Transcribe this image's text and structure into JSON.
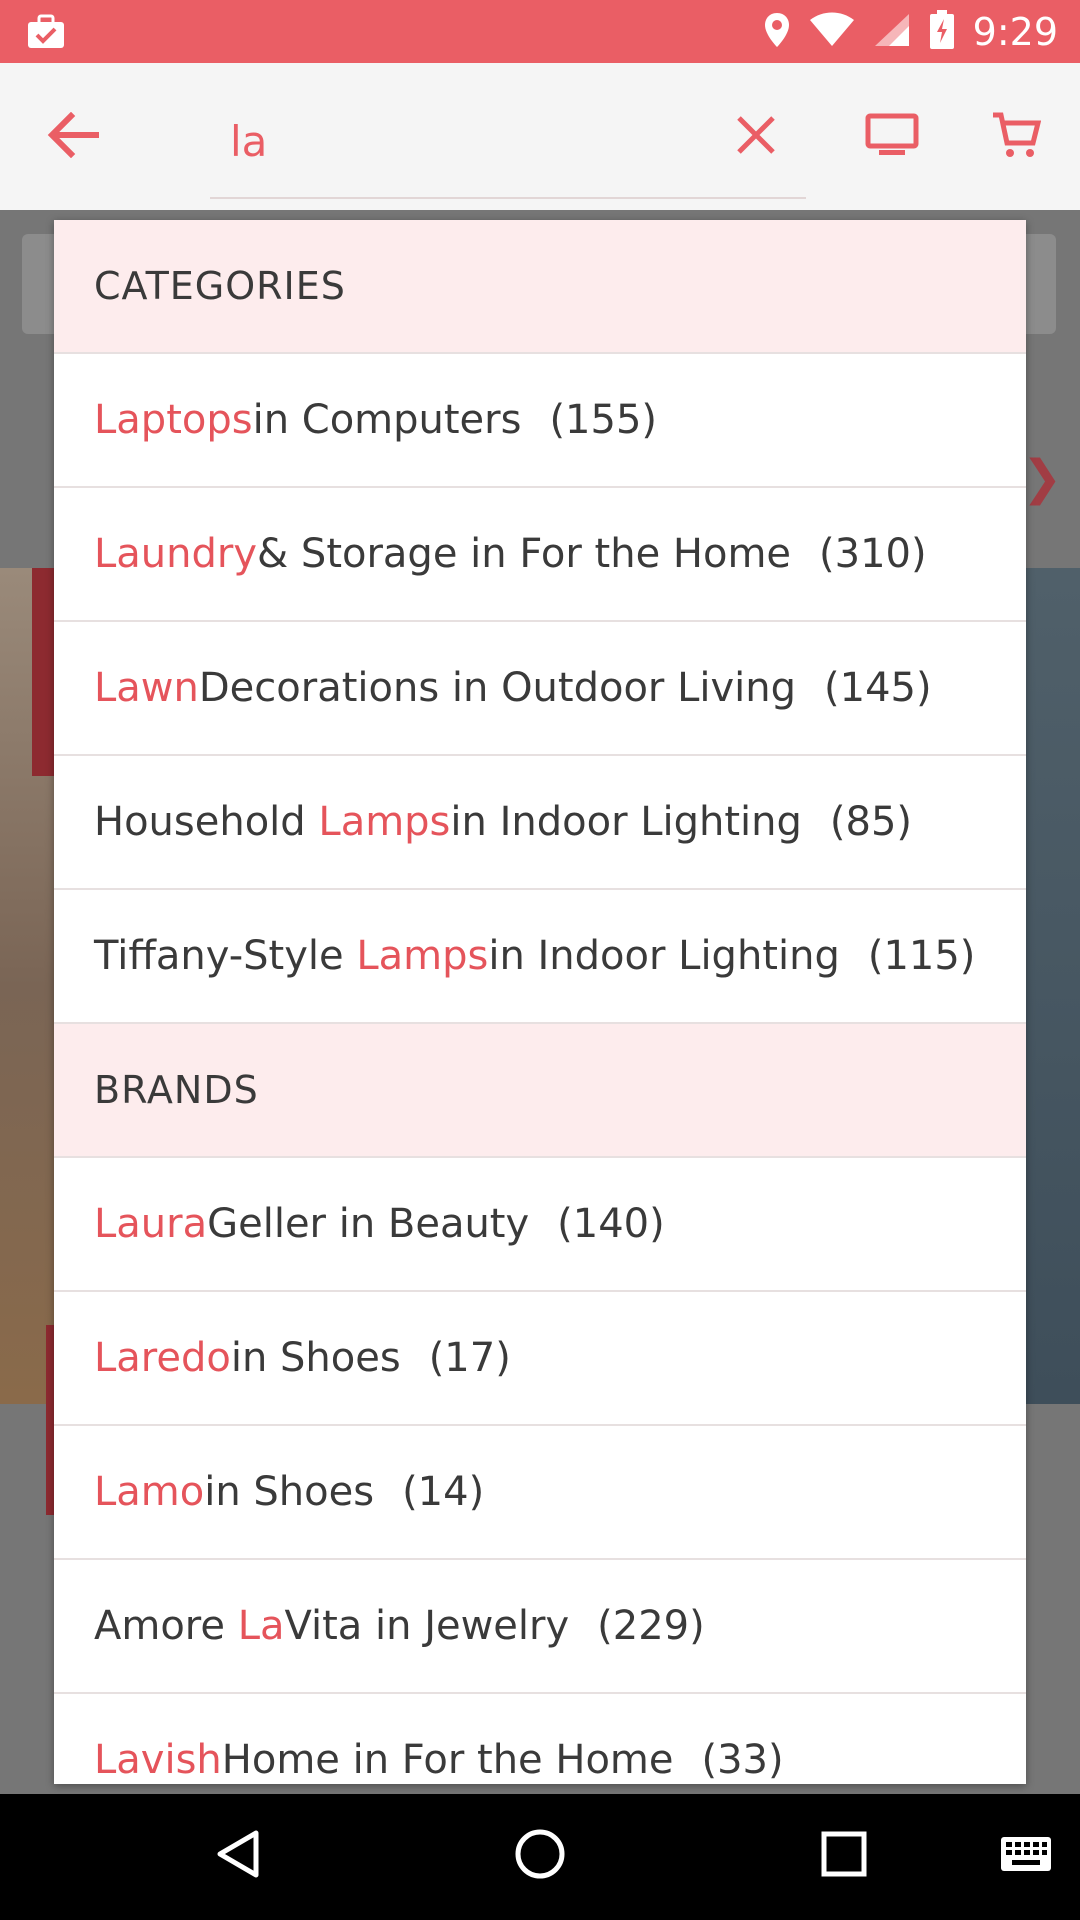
{
  "status_bar": {
    "time": "9:29"
  },
  "search": {
    "value": "la"
  },
  "colors": {
    "accent": "#ea5e65",
    "highlight": "#e5545b",
    "header_bg": "#fdeced"
  },
  "icons": {
    "status_left": "briefcase-check-icon",
    "location": "location-icon",
    "wifi": "wifi-icon",
    "signal": "signal-icon",
    "battery": "battery-charging-icon",
    "back": "arrow-left-icon",
    "clear": "close-icon",
    "tv": "monitor-icon",
    "cart": "cart-icon",
    "nav_back": "nav-back-icon",
    "nav_home": "nav-home-icon",
    "nav_recents": "nav-recents-icon",
    "nav_keyboard": "keyboard-icon"
  },
  "categories": {
    "header": "CATEGORIES",
    "items": [
      {
        "match": "Laptops",
        "rest": " in Computers",
        "count": "(155)"
      },
      {
        "match": "Laundry",
        "rest": " & Storage in For the Home",
        "count": "(310)"
      },
      {
        "match": "Lawn",
        "rest": " Decorations in Outdoor Living",
        "count": "(145)"
      },
      {
        "pre": "Household ",
        "match": "Lamps",
        "rest": " in Indoor Lighting",
        "count": "(85)"
      },
      {
        "pre": "Tiffany-Style ",
        "match": "Lamps",
        "rest": " in Indoor Lighting",
        "count": "(115)"
      }
    ]
  },
  "brands": {
    "header": "BRANDS",
    "items": [
      {
        "match": "Laura",
        "rest": " Geller in Beauty",
        "count": "(140)"
      },
      {
        "match": "Laredo",
        "rest": " in Shoes",
        "count": "(17)"
      },
      {
        "match": "Lamo",
        "rest": " in Shoes",
        "count": "(14)"
      },
      {
        "pre": "Amore ",
        "match": "La",
        "rest": " Vita in Jewelry",
        "count": "(229)"
      },
      {
        "match": "Lavish",
        "rest": " Home in For the Home",
        "count": "(33)"
      }
    ]
  }
}
